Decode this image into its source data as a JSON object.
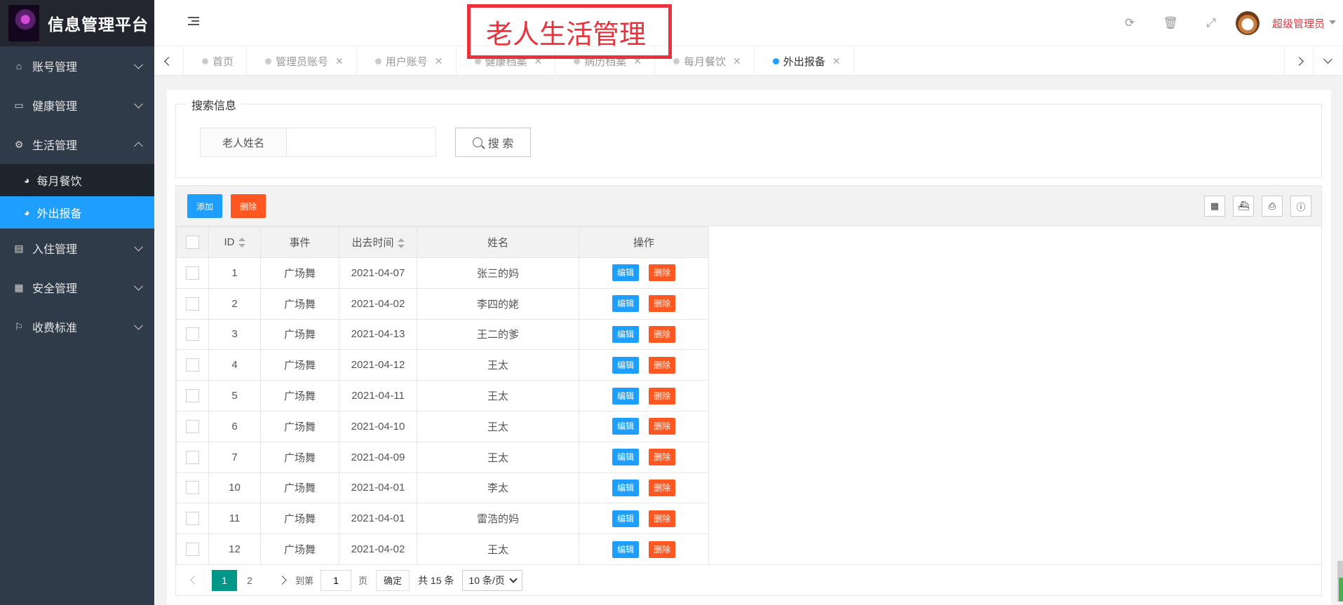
{
  "app": {
    "title": "信息管理平台"
  },
  "overlay_title": "老人生活管理",
  "sidebar": {
    "items": [
      {
        "label": "账号管理",
        "icon": "home-icon",
        "glyph": "⌂"
      },
      {
        "label": "健康管理",
        "icon": "window-icon",
        "glyph": "▭"
      },
      {
        "label": "生活管理",
        "icon": "gears-icon",
        "glyph": "⚙"
      },
      {
        "label": "入住管理",
        "icon": "file-icon",
        "glyph": "▤"
      },
      {
        "label": "安全管理",
        "icon": "calendar-icon",
        "glyph": "▦"
      },
      {
        "label": "收费标准",
        "icon": "flag-icon",
        "glyph": "⚐"
      }
    ],
    "sub_items": [
      {
        "label": "每月餐饮",
        "icon": "dashboard-icon",
        "glyph": "◕"
      },
      {
        "label": "外出报备",
        "icon": "dashboard-icon",
        "glyph": "◕"
      }
    ]
  },
  "header": {
    "user": "超级管理员",
    "icons": [
      "refresh-icon",
      "trash-icon",
      "fullscreen-icon"
    ]
  },
  "tabs": [
    {
      "label": "首页",
      "closable": false
    },
    {
      "label": "管理员账号",
      "closable": true
    },
    {
      "label": "用户账号",
      "closable": true
    },
    {
      "label": "健康档案",
      "closable": true
    },
    {
      "label": "病历档案",
      "closable": true
    },
    {
      "label": "每月餐饮",
      "closable": true
    },
    {
      "label": "外出报备",
      "closable": true
    }
  ],
  "search": {
    "legend": "搜索信息",
    "label": "老人姓名",
    "value": "",
    "button": "搜 索"
  },
  "toolbar": {
    "add": "添加",
    "delete": "删除"
  },
  "table": {
    "columns": [
      "ID",
      "事件",
      "出去时间",
      "姓名",
      "操作"
    ],
    "edit_label": "编辑",
    "delete_label": "删除",
    "rows": [
      [
        "1",
        "广场舞",
        "2021-04-07",
        "张三的妈"
      ],
      [
        "2",
        "广场舞",
        "2021-04-02",
        "李四的姥"
      ],
      [
        "3",
        "广场舞",
        "2021-04-13",
        "王二的爹"
      ],
      [
        "4",
        "广场舞",
        "2021-04-12",
        "王太"
      ],
      [
        "5",
        "广场舞",
        "2021-04-11",
        "王太"
      ],
      [
        "6",
        "广场舞",
        "2021-04-10",
        "王太"
      ],
      [
        "7",
        "广场舞",
        "2021-04-09",
        "王太"
      ],
      [
        "10",
        "广场舞",
        "2021-04-01",
        "李太"
      ],
      [
        "11",
        "广场舞",
        "2021-04-01",
        "雷浩的妈"
      ],
      [
        "12",
        "广场舞",
        "2021-04-02",
        "王太"
      ]
    ]
  },
  "pager": {
    "pages": [
      "1",
      "2"
    ],
    "goto_label": "到第",
    "goto_value": "1",
    "page_suffix": "页",
    "confirm": "确定",
    "total": "共 15 条",
    "per_page": "10 条/页"
  }
}
